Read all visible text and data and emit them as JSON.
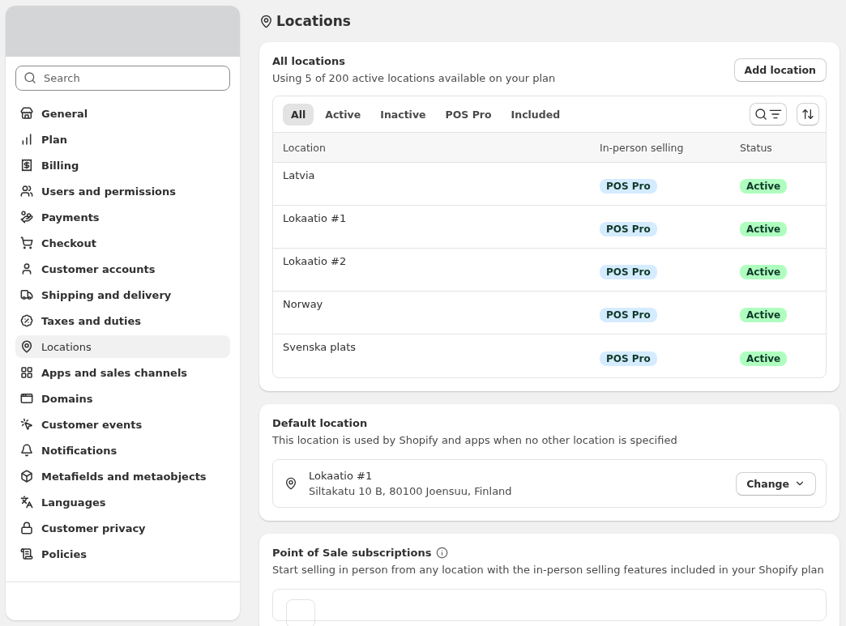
{
  "sidebar": {
    "search": {
      "placeholder": "Search"
    },
    "items": [
      {
        "label": "General",
        "selected": false
      },
      {
        "label": "Plan",
        "selected": false
      },
      {
        "label": "Billing",
        "selected": false
      },
      {
        "label": "Users and permissions",
        "selected": false
      },
      {
        "label": "Payments",
        "selected": false
      },
      {
        "label": "Checkout",
        "selected": false
      },
      {
        "label": "Customer accounts",
        "selected": false
      },
      {
        "label": "Shipping and delivery",
        "selected": false
      },
      {
        "label": "Taxes and duties",
        "selected": false
      },
      {
        "label": "Locations",
        "selected": true
      },
      {
        "label": "Apps and sales channels",
        "selected": false
      },
      {
        "label": "Domains",
        "selected": false
      },
      {
        "label": "Customer events",
        "selected": false
      },
      {
        "label": "Notifications",
        "selected": false
      },
      {
        "label": "Metafields and metaobjects",
        "selected": false
      },
      {
        "label": "Languages",
        "selected": false
      },
      {
        "label": "Customer privacy",
        "selected": false
      },
      {
        "label": "Policies",
        "selected": false
      }
    ]
  },
  "page": {
    "title": "Locations"
  },
  "all_locations": {
    "title": "All locations",
    "subtitle": "Using 5 of 200 active locations available on your plan",
    "add_button": "Add location",
    "tabs": [
      {
        "label": "All",
        "selected": true
      },
      {
        "label": "Active",
        "selected": false
      },
      {
        "label": "Inactive",
        "selected": false
      },
      {
        "label": "POS Pro",
        "selected": false
      },
      {
        "label": "Included",
        "selected": false
      }
    ],
    "columns": [
      "Location",
      "In-person selling",
      "Status"
    ],
    "rows": [
      {
        "location": "Latvia",
        "selling": "POS Pro",
        "status": "Active"
      },
      {
        "location": "Lokaatio #1",
        "selling": "POS Pro",
        "status": "Active"
      },
      {
        "location": "Lokaatio #2",
        "selling": "POS Pro",
        "status": "Active"
      },
      {
        "location": "Norway",
        "selling": "POS Pro",
        "status": "Active"
      },
      {
        "location": "Svenska plats",
        "selling": "POS Pro",
        "status": "Active"
      }
    ]
  },
  "default_location": {
    "title": "Default location",
    "subtitle": "This location is used by Shopify and apps when no other location is specified",
    "name": "Lokaatio #1",
    "address": "Siltakatu 10 B, 80100 Joensuu, Finland",
    "change_button": "Change"
  },
  "pos_subscriptions": {
    "title": "Point of Sale subscriptions",
    "subtitle": "Start selling in person from any location with the in-person selling features included in your Shopify plan"
  }
}
